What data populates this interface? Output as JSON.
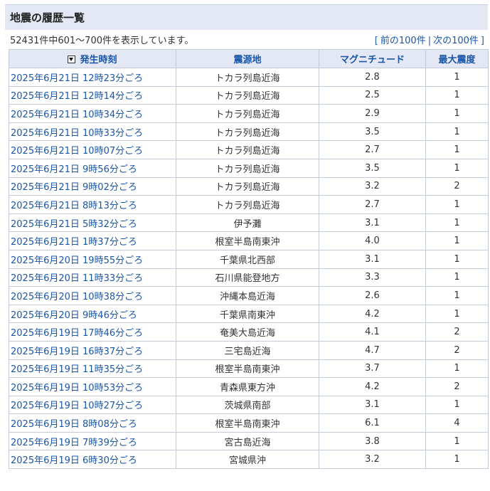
{
  "heading": "地震の履歴一覧",
  "summary": "52431件中601～700件を表示しています。",
  "pager": {
    "open": "[",
    "prev": "前の100件",
    "sep": "|",
    "next": "次の100件",
    "close": "]"
  },
  "columns": {
    "time": "発生時刻",
    "epicenter": "震源地",
    "magnitude": "マグニチュード",
    "intensity": "最大震度"
  },
  "rows": [
    {
      "time": "2025年6月21日 12時23分ごろ",
      "epicenter": "トカラ列島近海",
      "magnitude": "2.8",
      "intensity": "1"
    },
    {
      "time": "2025年6月21日 12時14分ごろ",
      "epicenter": "トカラ列島近海",
      "magnitude": "2.5",
      "intensity": "1"
    },
    {
      "time": "2025年6月21日 10時34分ごろ",
      "epicenter": "トカラ列島近海",
      "magnitude": "2.9",
      "intensity": "1"
    },
    {
      "time": "2025年6月21日 10時33分ごろ",
      "epicenter": "トカラ列島近海",
      "magnitude": "3.5",
      "intensity": "1"
    },
    {
      "time": "2025年6月21日 10時07分ごろ",
      "epicenter": "トカラ列島近海",
      "magnitude": "2.7",
      "intensity": "1"
    },
    {
      "time": "2025年6月21日 9時56分ごろ",
      "epicenter": "トカラ列島近海",
      "magnitude": "3.5",
      "intensity": "1"
    },
    {
      "time": "2025年6月21日 9時02分ごろ",
      "epicenter": "トカラ列島近海",
      "magnitude": "3.2",
      "intensity": "2"
    },
    {
      "time": "2025年6月21日 8時13分ごろ",
      "epicenter": "トカラ列島近海",
      "magnitude": "2.7",
      "intensity": "1"
    },
    {
      "time": "2025年6月21日 5時32分ごろ",
      "epicenter": "伊予灘",
      "magnitude": "3.1",
      "intensity": "1"
    },
    {
      "time": "2025年6月21日 1時37分ごろ",
      "epicenter": "根室半島南東沖",
      "magnitude": "4.0",
      "intensity": "1"
    },
    {
      "time": "2025年6月20日 19時55分ごろ",
      "epicenter": "千葉県北西部",
      "magnitude": "3.1",
      "intensity": "1"
    },
    {
      "time": "2025年6月20日 11時33分ごろ",
      "epicenter": "石川県能登地方",
      "magnitude": "3.3",
      "intensity": "1"
    },
    {
      "time": "2025年6月20日 10時38分ごろ",
      "epicenter": "沖縄本島近海",
      "magnitude": "2.6",
      "intensity": "1"
    },
    {
      "time": "2025年6月20日 9時46分ごろ",
      "epicenter": "千葉県南東沖",
      "magnitude": "4.2",
      "intensity": "1"
    },
    {
      "time": "2025年6月19日 17時46分ごろ",
      "epicenter": "奄美大島近海",
      "magnitude": "4.1",
      "intensity": "2"
    },
    {
      "time": "2025年6月19日 16時37分ごろ",
      "epicenter": "三宅島近海",
      "magnitude": "4.7",
      "intensity": "2"
    },
    {
      "time": "2025年6月19日 11時35分ごろ",
      "epicenter": "根室半島南東沖",
      "magnitude": "3.7",
      "intensity": "1"
    },
    {
      "time": "2025年6月19日 10時53分ごろ",
      "epicenter": "青森県東方沖",
      "magnitude": "4.2",
      "intensity": "2"
    },
    {
      "time": "2025年6月19日 10時27分ごろ",
      "epicenter": "茨城県南部",
      "magnitude": "3.1",
      "intensity": "1"
    },
    {
      "time": "2025年6月19日 8時08分ごろ",
      "epicenter": "根室半島南東沖",
      "magnitude": "6.1",
      "intensity": "4"
    },
    {
      "time": "2025年6月19日 7時39分ごろ",
      "epicenter": "宮古島近海",
      "magnitude": "3.8",
      "intensity": "1"
    },
    {
      "time": "2025年6月19日 6時30分ごろ",
      "epicenter": "宮城県沖",
      "magnitude": "3.2",
      "intensity": "1"
    }
  ]
}
